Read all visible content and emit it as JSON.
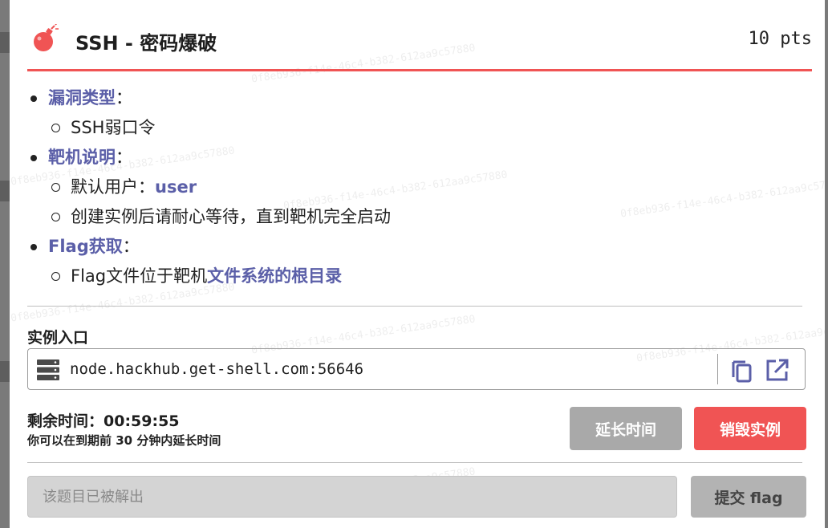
{
  "challenge": {
    "title": "SSH - 密码爆破",
    "points": "10 pts"
  },
  "description": {
    "vuln_type_label": "漏洞类型",
    "vuln_type_value": "SSH弱口令",
    "target_label": "靶机说明",
    "default_user_prefix": "默认用户：",
    "default_user_value": "user",
    "startup_note": "创建实例后请耐心等待，直到靶机完全启动",
    "flag_label": "Flag获取",
    "flag_location_prefix": "Flag文件位于靶机",
    "flag_location_link": "文件系统的根目录",
    "colon": "："
  },
  "instance": {
    "section_label": "实例入口",
    "address": "node.hackhub.get-shell.com:56646"
  },
  "timer": {
    "label": "剩余时间：00:59:55",
    "hint": "你可以在到期前 30 分钟内延长时间"
  },
  "buttons": {
    "extend": "延长时间",
    "destroy": "销毁实例",
    "submit": "提交 flag"
  },
  "flag_input": {
    "placeholder": "该题目已被解出"
  },
  "watermark": "0f8eb936-f14e-46c4-b382-612aa9c57880",
  "colors": {
    "accent": "#f05454",
    "link": "#5b5fa8",
    "disabled": "#a9a9a9"
  },
  "icons": [
    "bomb-icon",
    "server-icon",
    "copy-icon",
    "external-link-icon"
  ]
}
